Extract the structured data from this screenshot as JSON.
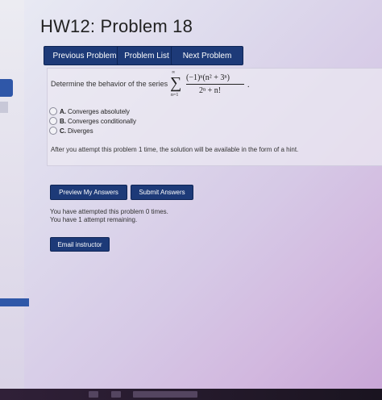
{
  "page": {
    "title": "HW12: Problem 18"
  },
  "nav": {
    "previous": "Previous Problem",
    "list": "Problem List",
    "next": "Next Problem"
  },
  "problem": {
    "prompt": "Determine the behavior of the series",
    "series": {
      "upper": "∞",
      "lower": "n=1",
      "sigma": "∑",
      "numerator": "(−1)ⁿ(n² + 3ⁿ)",
      "denominator": "2ⁿ + n!",
      "trail": "."
    },
    "options": [
      {
        "letter": "A.",
        "text": "Converges absolutely"
      },
      {
        "letter": "B.",
        "text": "Converges conditionally"
      },
      {
        "letter": "C.",
        "text": "Diverges"
      }
    ],
    "hint_text": "After you attempt this problem 1 time, the solution will be available in the form of a hint."
  },
  "actions": {
    "preview": "Preview My Answers",
    "submit": "Submit Answers"
  },
  "status": {
    "attempted": "You have attempted this problem 0 times.",
    "remaining": "You have 1 attempt remaining."
  },
  "email": {
    "label": "Email instructor"
  },
  "colors": {
    "button_bg": "#1d3a78",
    "accent": "#2f57a8"
  }
}
